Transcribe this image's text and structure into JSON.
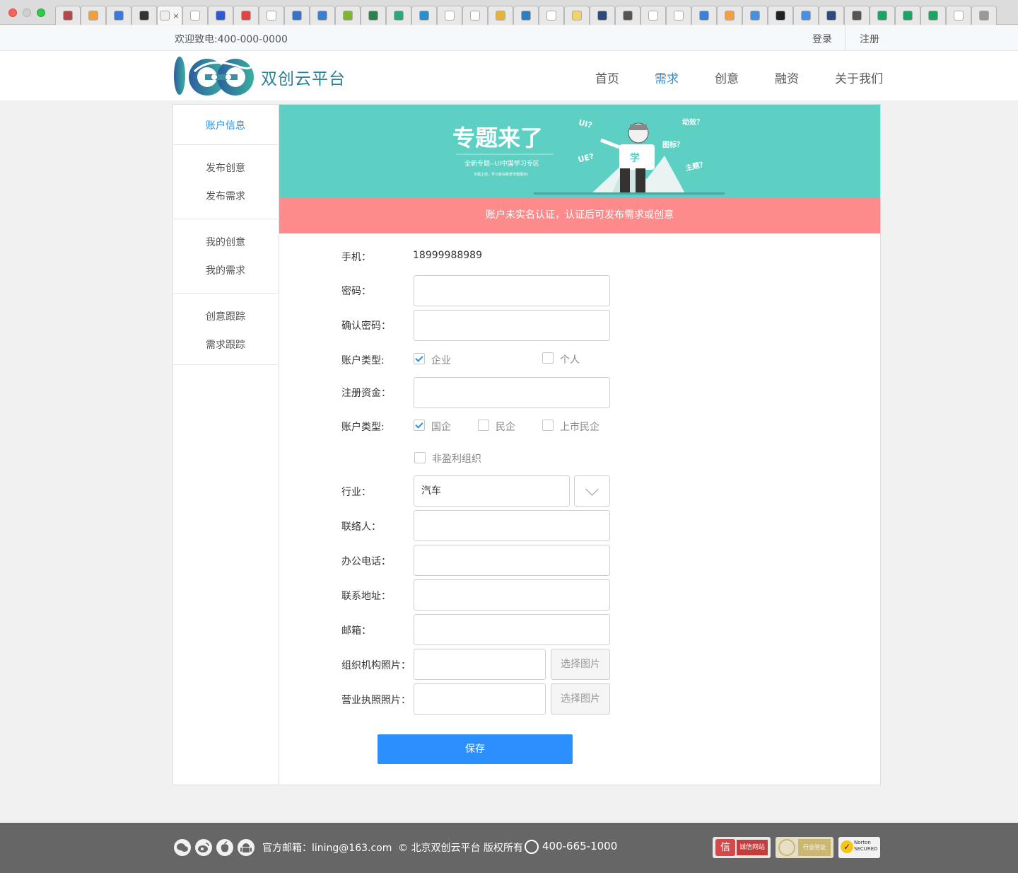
{
  "browser": {
    "tabs": [
      {
        "color": "#b04a4a"
      },
      {
        "color": "#f0a040"
      },
      {
        "color": "#3b7ad6"
      },
      {
        "color": "#333333"
      },
      {
        "color": "#eeeeee",
        "active": true
      },
      {
        "color": "#ffffff"
      },
      {
        "color": "#3358d4"
      },
      {
        "color": "#e04545"
      },
      {
        "color": "#ffffff"
      },
      {
        "color": "#3a72c8"
      },
      {
        "color": "#3a7fd0"
      },
      {
        "color": "#7cb72f"
      },
      {
        "color": "#2f7f4f"
      },
      {
        "color": "#2ea57a"
      },
      {
        "color": "#2a8fd0"
      },
      {
        "color": "#ffffff"
      },
      {
        "color": "#ffffff"
      },
      {
        "color": "#e6b33a"
      },
      {
        "color": "#2d7dbd"
      },
      {
        "color": "#ffffff"
      },
      {
        "color": "#f2d26a"
      },
      {
        "color": "#2c4a7a"
      },
      {
        "color": "#555555"
      },
      {
        "color": "#ffffff"
      },
      {
        "color": "#ffffff"
      },
      {
        "color": "#3a82d8"
      },
      {
        "color": "#f0a040"
      },
      {
        "color": "#4a90d9"
      },
      {
        "color": "#222222"
      },
      {
        "color": "#4a8fe0"
      },
      {
        "color": "#2b4c7c"
      },
      {
        "color": "#555555"
      },
      {
        "color": "#1da462"
      },
      {
        "color": "#1da462"
      },
      {
        "color": "#1da462"
      },
      {
        "color": "#ffffff"
      },
      {
        "color": "#999999"
      }
    ]
  },
  "topbar": {
    "welcome": "欢迎致电:400-000-0000",
    "login": "登录",
    "register": "注册"
  },
  "header": {
    "brand": "双创云平台",
    "nav": [
      "首页",
      "需求",
      "创意",
      "融资",
      "关于我们"
    ],
    "active_nav": "需求"
  },
  "sidebar": {
    "groups": [
      [
        "账户信息"
      ],
      [
        "发布创意",
        "发布需求"
      ],
      [
        "我的创意",
        "我的需求"
      ],
      [
        "创意跟踪",
        "需求跟踪"
      ]
    ],
    "active": "账户信息"
  },
  "banner": {
    "title": "专题来了",
    "subtitle": "全新专题--UI中国学习专区",
    "small": "专题上线，学习板块新增专题模块！",
    "tags": [
      "UI?",
      "UE?",
      "动效？",
      "图标？",
      "主题？"
    ],
    "character_text": "学"
  },
  "alert": "账户未实名认证，认证后可发布需求或创意",
  "form": {
    "phone_label": "手机：",
    "phone_value": "18999988989",
    "password_label": "密码：",
    "confirm_label": "确认密码：",
    "account_type_label": "账户类型:",
    "account_types": [
      {
        "label": "企业",
        "checked": true
      },
      {
        "label": "个人",
        "checked": false
      }
    ],
    "capital_label": "注册资金：",
    "company_type_label": "账户类型:",
    "company_types": [
      {
        "label": "国企",
        "checked": true
      },
      {
        "label": "民企",
        "checked": false
      },
      {
        "label": "上市民企",
        "checked": false
      },
      {
        "label": "非盈利组织",
        "checked": false
      }
    ],
    "industry_label": "行业：",
    "industry_value": "汽车",
    "contact_label": "联络人：",
    "office_phone_label": "办公电话：",
    "address_label": "联系地址：",
    "email_label": "邮箱：",
    "org_photo_label": "组织机构照片：",
    "license_photo_label": "营业执照照片：",
    "choose_image": "选择图片",
    "save": "保存"
  },
  "footer": {
    "icons": [
      "wechat-icon",
      "weibo-icon",
      "apple-icon",
      "android-icon"
    ],
    "email": "官方邮箱：lining@163.com",
    "copyright": "© 北京双创云平台 版权所有",
    "phone": "400-665-1000",
    "badges": [
      "诚信网站",
      "行业验证",
      "Norton SECURED"
    ]
  }
}
